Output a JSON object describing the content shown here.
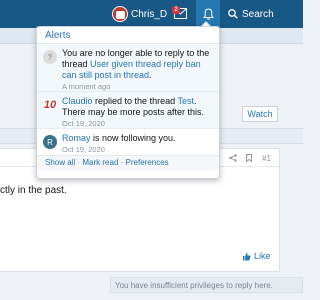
{
  "navbar": {
    "username": "Chris_D",
    "inbox_count": "2",
    "search_label": "Search"
  },
  "alerts_menu": {
    "title": "Alerts",
    "items": [
      {
        "text_before": "You are no longer able to reply to the thread ",
        "link": "User given thread reply ban can still post in thread",
        "text_after": ".",
        "time": "A moment ago",
        "avatar": "question-mark-icon"
      },
      {
        "actor": "Claudio",
        "text_middle": " replied to the thread ",
        "thread": "Test",
        "text_after": ". There may be more posts after this.",
        "time": "Oct 19, 2020",
        "avatar_letter": "10"
      },
      {
        "actor": "Romay",
        "text_after": " is now following you.",
        "time": "Oct 19, 2020",
        "avatar_letter": "R"
      }
    ],
    "footer": {
      "show_all": "Show all",
      "sep": "·",
      "mark_read": "Mark read",
      "preferences": "Preferences"
    }
  },
  "page": {
    "watch_label": "Watch",
    "post_number": "#1",
    "post_text": "ctly in the past.",
    "like_label": "Like",
    "insufficient_privileges": "You have insufficient privileges to reply here."
  },
  "colors": {
    "navbar": "#185886",
    "accent": "#2577b1",
    "badge": "#e03030"
  }
}
